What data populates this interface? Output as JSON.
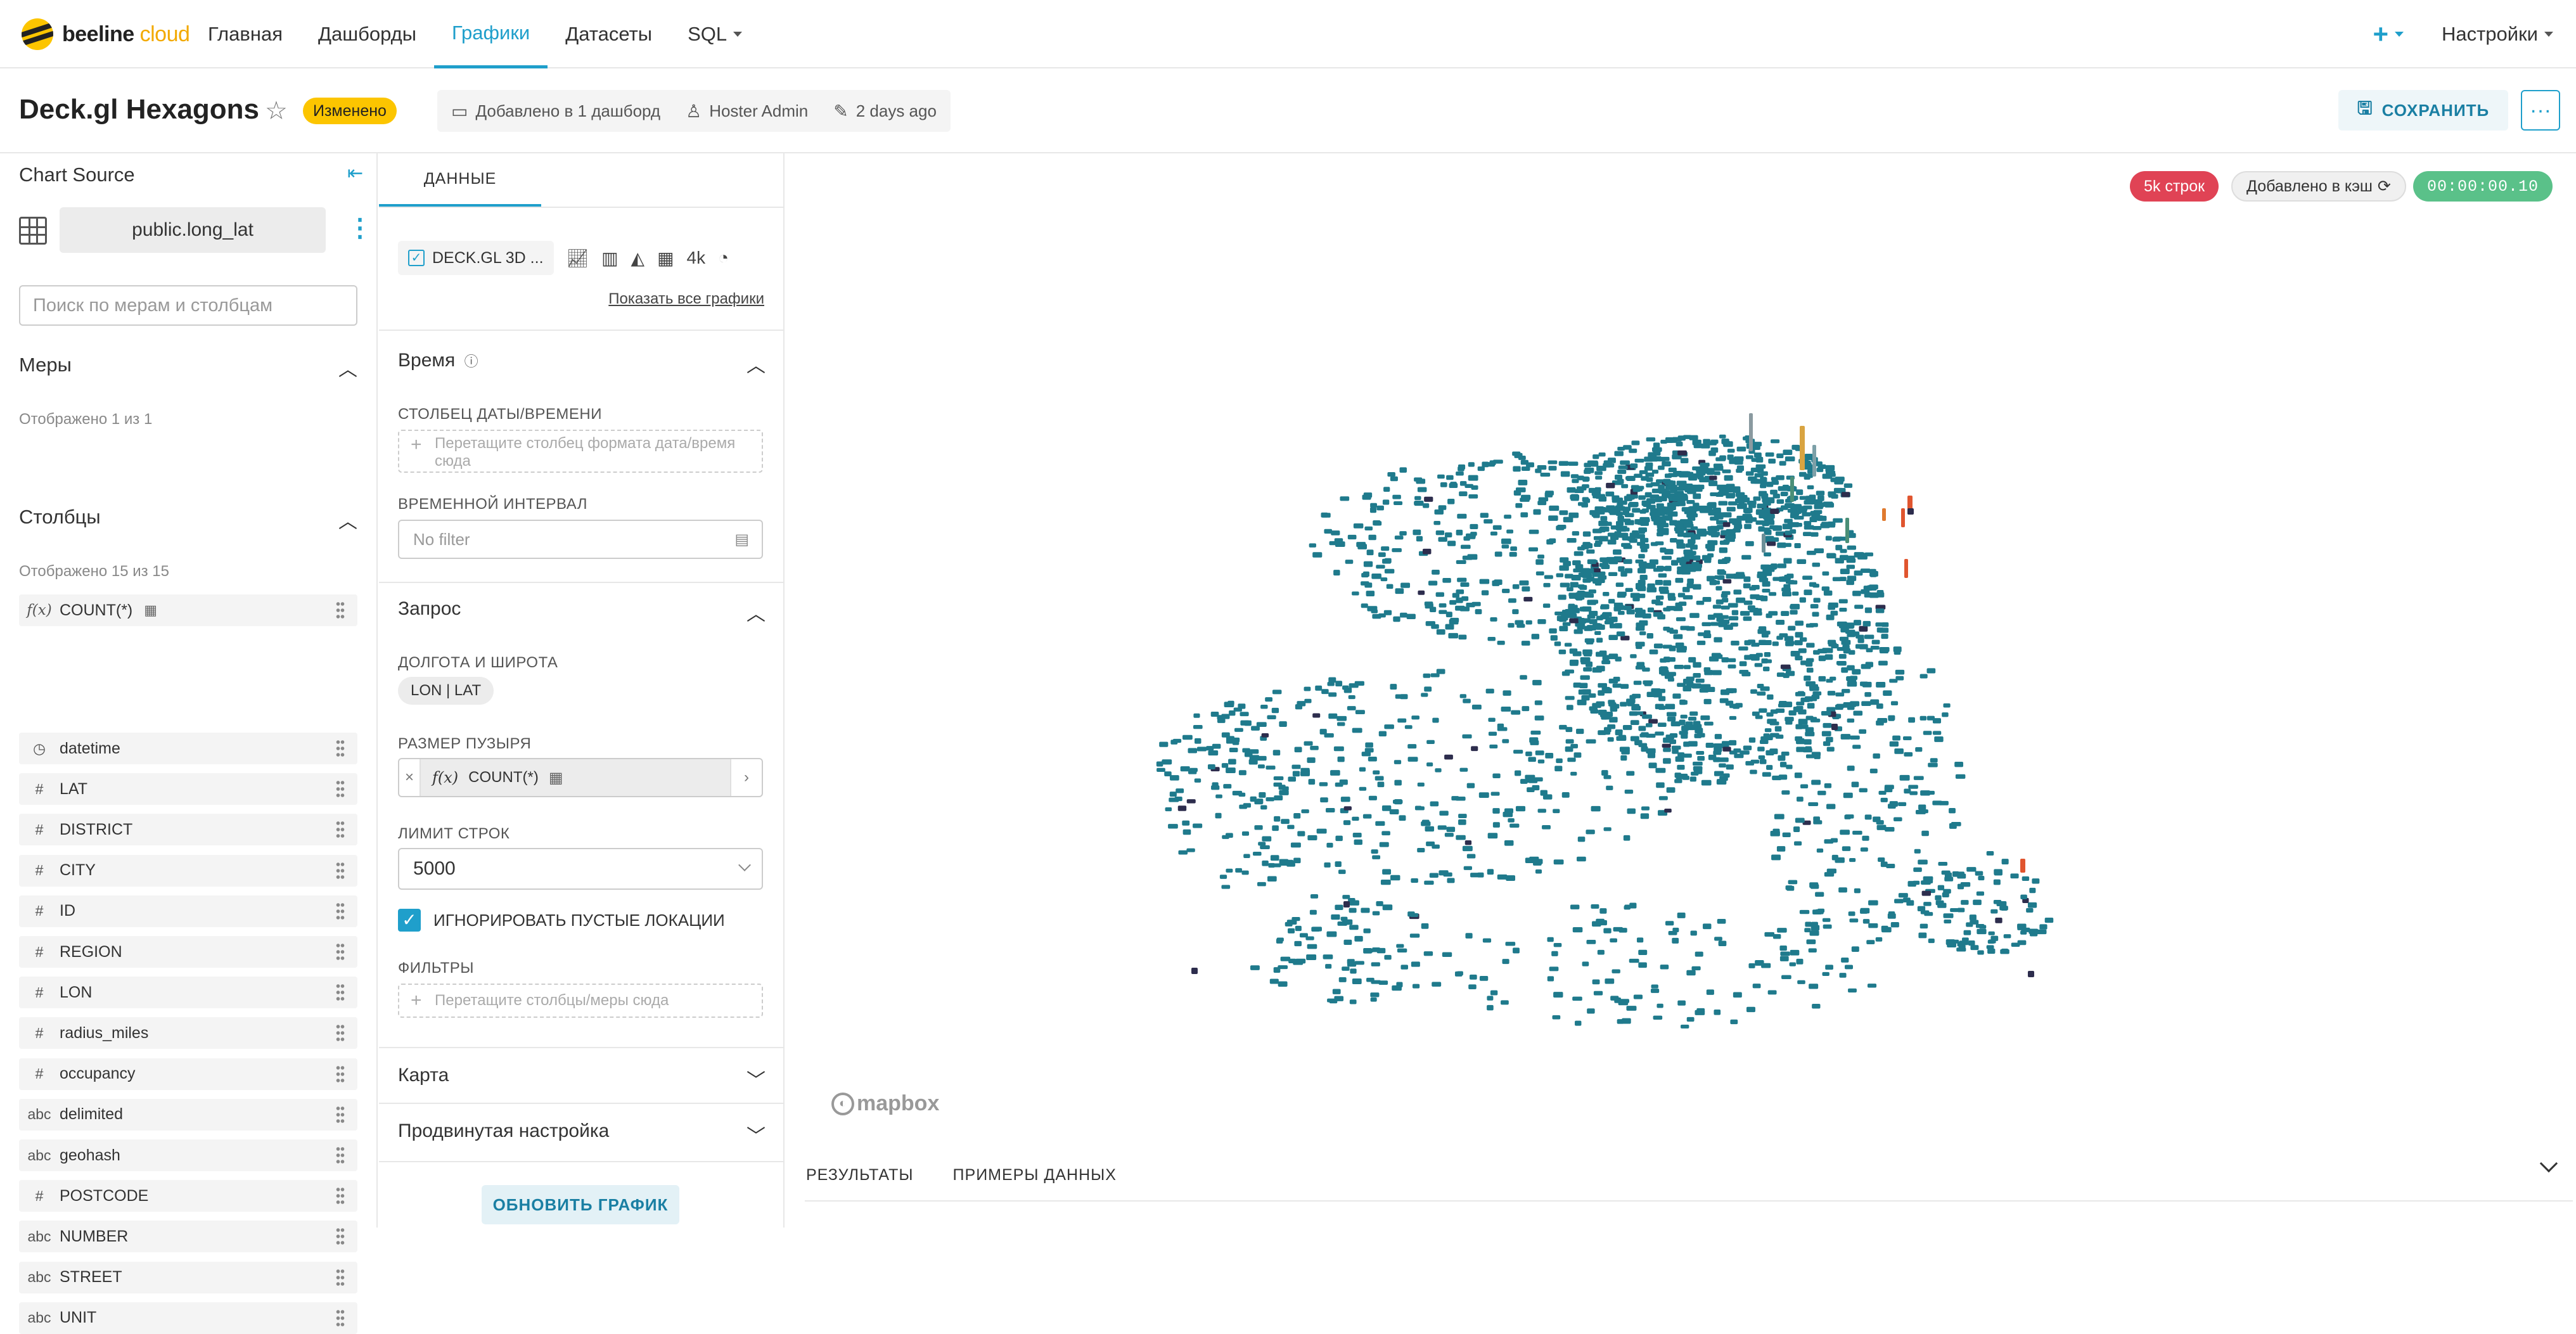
{
  "nav": {
    "logo_main": "beeline",
    "logo_sub": "cloud",
    "links": [
      "Главная",
      "Дашборды",
      "Графики",
      "Датасеты",
      "SQL"
    ],
    "active_link": "Графики",
    "plus": "+",
    "settings": "Настройки"
  },
  "header": {
    "title": "Deck.gl Hexagons",
    "modified_badge": "Изменено",
    "added_to": "Добавлено в 1 дашборд",
    "owner": "Hoster Admin",
    "edited": "2 days ago",
    "save_label": "СОХРАНИТЬ",
    "more_label": "···"
  },
  "source": {
    "title": "Chart Source",
    "dataset": "public.long_lat",
    "search_placeholder": "Поиск по мерам и столбцам",
    "measures_title": "Меры",
    "measures_shown": "Отображено 1 из 1",
    "measures": [
      {
        "type": "f(x)",
        "name": "COUNT(*)"
      }
    ],
    "columns_title": "Столбцы",
    "columns_shown": "Отображено 15 из 15",
    "columns": [
      {
        "type": "◷",
        "name": "datetime"
      },
      {
        "type": "#",
        "name": "LAT"
      },
      {
        "type": "#",
        "name": "DISTRICT"
      },
      {
        "type": "#",
        "name": "CITY"
      },
      {
        "type": "#",
        "name": "ID"
      },
      {
        "type": "#",
        "name": "REGION"
      },
      {
        "type": "#",
        "name": "LON"
      },
      {
        "type": "#",
        "name": "radius_miles"
      },
      {
        "type": "#",
        "name": "occupancy"
      },
      {
        "type": "abc",
        "name": "delimited"
      },
      {
        "type": "abc",
        "name": "geohash"
      },
      {
        "type": "#",
        "name": "POSTCODE"
      },
      {
        "type": "abc",
        "name": "NUMBER"
      },
      {
        "type": "abc",
        "name": "STREET"
      },
      {
        "type": "abc",
        "name": "UNIT"
      }
    ]
  },
  "config": {
    "tab": "ДАННЫЕ",
    "viz_name": "DECK.GL 3D ...",
    "viz_more": "4k",
    "show_all": "Показать все графики",
    "time_section": "Время",
    "time_col_label": "СТОЛБЕЦ ДАТЫ/ВРЕМЕНИ",
    "time_col_placeholder": "Перетащите столбец формата дата/время сюда",
    "time_range_label": "ВРЕМЕННОЙ ИНТЕРВАЛ",
    "time_range_value": "No filter",
    "query_section": "Запрос",
    "lonlat_label": "ДОЛГОТА И ШИРОТА",
    "lonlat_value": "LON | LAT",
    "bubble_label": "РАЗМЕР ПУЗЫРЯ",
    "bubble_fx": "f(x)",
    "bubble_value": "COUNT(*)",
    "row_limit_label": "ЛИМИТ СТРОК",
    "row_limit_value": "5000",
    "ignore_empty_label": "ИГНОРИРОВАТЬ ПУСТЫЕ ЛОКАЦИИ",
    "filters_label": "ФИЛЬТРЫ",
    "filters_placeholder": "Перетащите столбцы/меры сюда",
    "map_section": "Карта",
    "advanced_section": "Продвинутая настройка",
    "update_button": "ОБНОВИТЬ ГРАФИК"
  },
  "result": {
    "rows_badge": "5k строк",
    "cache_badge": "Добавлено в кэш",
    "time_badge": "00:00:00.10",
    "mapbox_label": "mapbox",
    "tab_results": "РЕЗУЛЬТАТЫ",
    "tab_samples": "ПРИМЕРЫ ДАННЫХ"
  },
  "colors": {
    "accent": "#1f9fcb",
    "modified": "#fcc500",
    "rows_badge": "#e04355",
    "time_badge": "#5ac189",
    "hexagon_main": "#1f7a8c",
    "hexagon_dark": "#2d2d4d",
    "hexagon_hot": "#e0552f"
  }
}
